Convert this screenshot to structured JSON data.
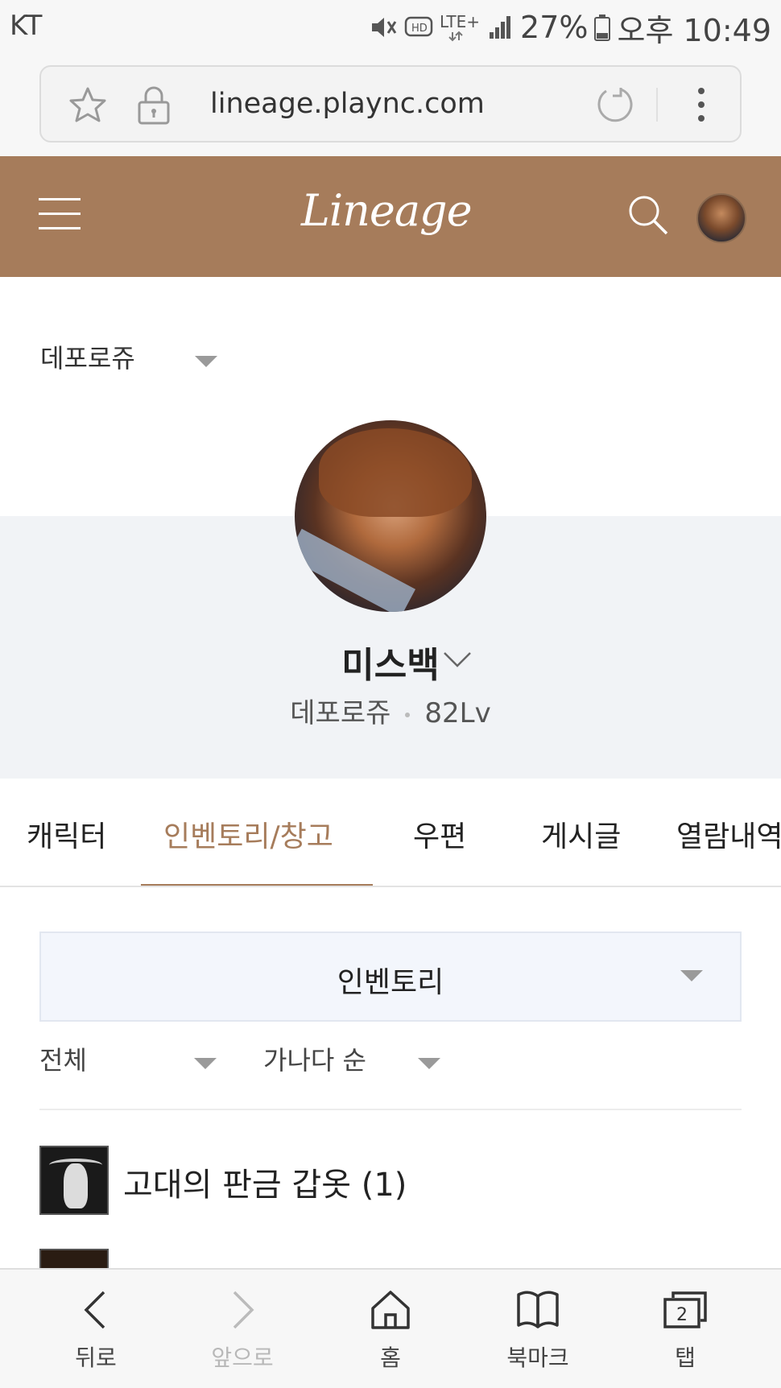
{
  "status_bar": {
    "carrier": "KT",
    "network": "LTE+",
    "battery": "27%",
    "time": "오후 10:49",
    "icons": [
      "mute-icon",
      "hd-voice-icon",
      "lte-icon",
      "signal-icon",
      "battery-icon"
    ]
  },
  "browser": {
    "url": "lineage.plaync.com"
  },
  "header": {
    "logo_text": "Lineage",
    "brand_color": "#a67c5b"
  },
  "server_select": {
    "value": "데포로쥬"
  },
  "profile": {
    "name": "미스백",
    "server": "데포로쥬",
    "level": "82Lv"
  },
  "tabs": [
    {
      "label": "캐릭터",
      "active": false
    },
    {
      "label": "인벤토리/창고",
      "active": true
    },
    {
      "label": "우편",
      "active": false
    },
    {
      "label": "게시글",
      "active": false
    },
    {
      "label": "열람내역",
      "active": false
    }
  ],
  "inventory": {
    "selected": "인벤토리",
    "filter_category": "전체",
    "filter_sort": "가나다 순",
    "items": [
      {
        "name": "고대의 판금 갑옷 (1)"
      }
    ]
  },
  "bottom_nav": [
    {
      "label": "뒤로",
      "icon": "back-icon"
    },
    {
      "label": "앞으로",
      "icon": "forward-icon"
    },
    {
      "label": "홈",
      "icon": "home-icon"
    },
    {
      "label": "북마크",
      "icon": "bookmark-icon"
    },
    {
      "label": "탭",
      "icon": "tabs-icon",
      "count": "2"
    }
  ]
}
